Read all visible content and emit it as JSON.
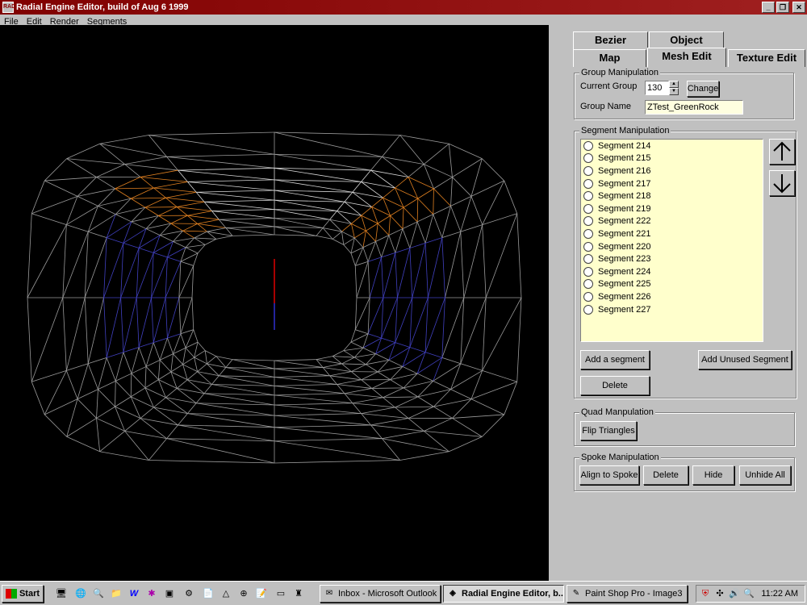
{
  "window": {
    "title": "Radial Engine Editor, build of Aug  6 1999",
    "icon_text": "RAD",
    "minimize": "_",
    "restore": "❐",
    "close": "✕"
  },
  "menu": [
    {
      "label": "File"
    },
    {
      "label": "Edit"
    },
    {
      "label": "Render"
    },
    {
      "label": "Segments"
    }
  ],
  "tabs": {
    "row1": [
      "Bezier",
      "Object"
    ],
    "row2": [
      "Map",
      "Mesh Edit",
      "Texture Edit"
    ],
    "active": "Mesh Edit"
  },
  "group_manipulation": {
    "label": "Group Manipulation",
    "current_group_label": "Current Group",
    "current_group_value": "130",
    "change_button": "Change",
    "group_name_label": "Group Name",
    "group_name_value": "ZTest_GreenRock"
  },
  "segment_manipulation": {
    "label": "Segment Manipulation",
    "segments": [
      "Segment 214",
      "Segment 215",
      "Segment 216",
      "Segment 217",
      "Segment 218",
      "Segment 219",
      "Segment 222",
      "Segment 221",
      "Segment 220",
      "Segment 223",
      "Segment 224",
      "Segment 225",
      "Segment 226",
      "Segment 227"
    ],
    "add_segment_button": "Add a segment",
    "add_unused_button": "Add Unused Segment",
    "delete_button": "Delete"
  },
  "quad_manipulation": {
    "label": "Quad Manpulation",
    "flip_button": "Flip Triangles"
  },
  "spoke_manipulation": {
    "label": "Spoke Manipulation",
    "align_button": "Align to Spoke",
    "delete_button": "Delete",
    "hide_button": "Hide",
    "unhide_button": "Unhide All"
  },
  "taskbar": {
    "start_label": "Start",
    "tasks": [
      {
        "label": "Inbox - Microsoft Outlook",
        "active": false
      },
      {
        "label": "Radial Engine Editor, b...",
        "active": true
      },
      {
        "label": "Paint Shop Pro - Image3",
        "active": false
      }
    ],
    "clock": "11:22 AM"
  },
  "colors": {
    "titlebar": "#800000",
    "viewport_bg": "#000000",
    "wire_white": "#d8d8d8",
    "wire_orange": "#e08020",
    "wire_blue": "#4040c0",
    "list_bg": "#ffffcc"
  }
}
